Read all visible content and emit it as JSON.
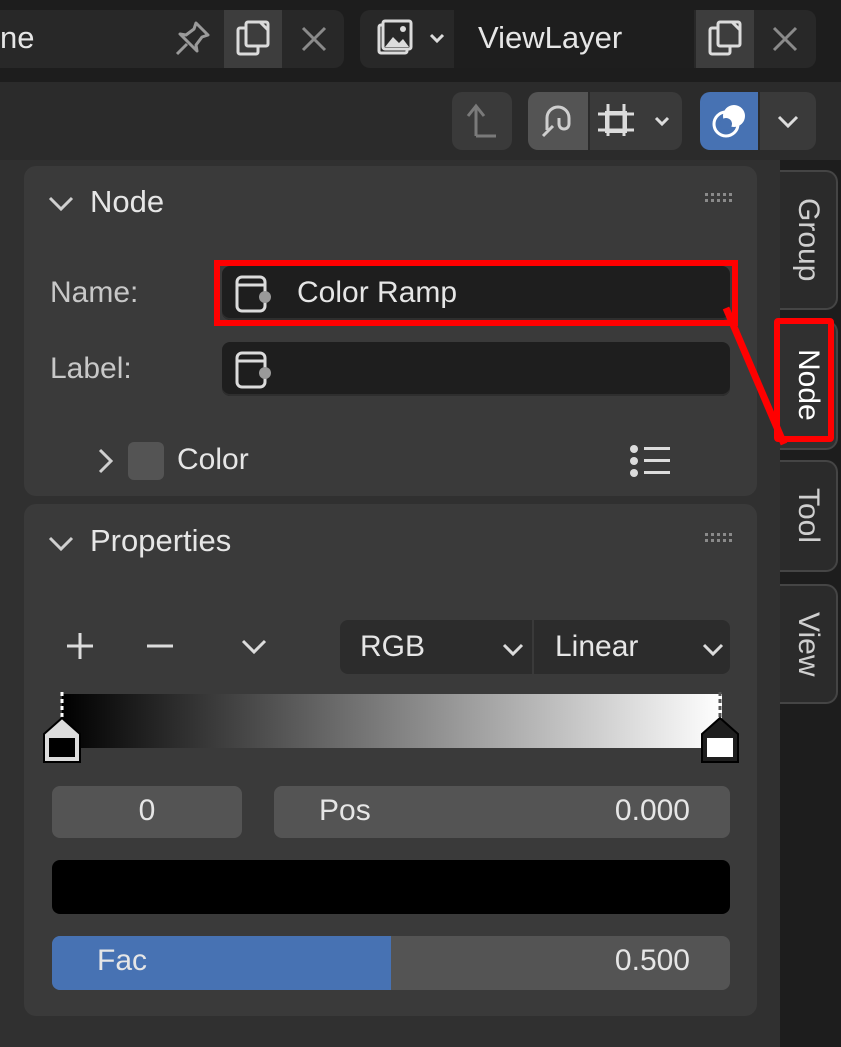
{
  "header": {
    "scene_name": "ne",
    "view_layer": "ViewLayer"
  },
  "tabs": [
    {
      "label": "Group"
    },
    {
      "label": "Node"
    },
    {
      "label": "Tool"
    },
    {
      "label": "View"
    }
  ],
  "node_panel": {
    "title": "Node",
    "name_label": "Name:",
    "name_value": "Color Ramp",
    "label_label": "Label:",
    "label_value": "",
    "color_label": "Color"
  },
  "properties_panel": {
    "title": "Properties",
    "color_mode": "RGB",
    "interpolation": "Linear",
    "stop_index": "0",
    "pos_label": "Pos",
    "pos_value": "0.000",
    "fac_label": "Fac",
    "fac_value": "0.500",
    "fac_fraction": 0.5
  },
  "colors": {
    "accent": "#4772b3",
    "highlight": "#ff0000",
    "active_tab_icon": "#4772b3"
  },
  "icons": [
    "pin-icon",
    "copy-icon",
    "close-icon",
    "image-stack-icon",
    "parent-arrow-icon",
    "snap-icon",
    "grid-snap-icon",
    "overlay-icon",
    "chevron-down-icon",
    "node-icon",
    "preset-list-icon",
    "drag-grip-icon",
    "plus-icon",
    "minus-icon"
  ]
}
